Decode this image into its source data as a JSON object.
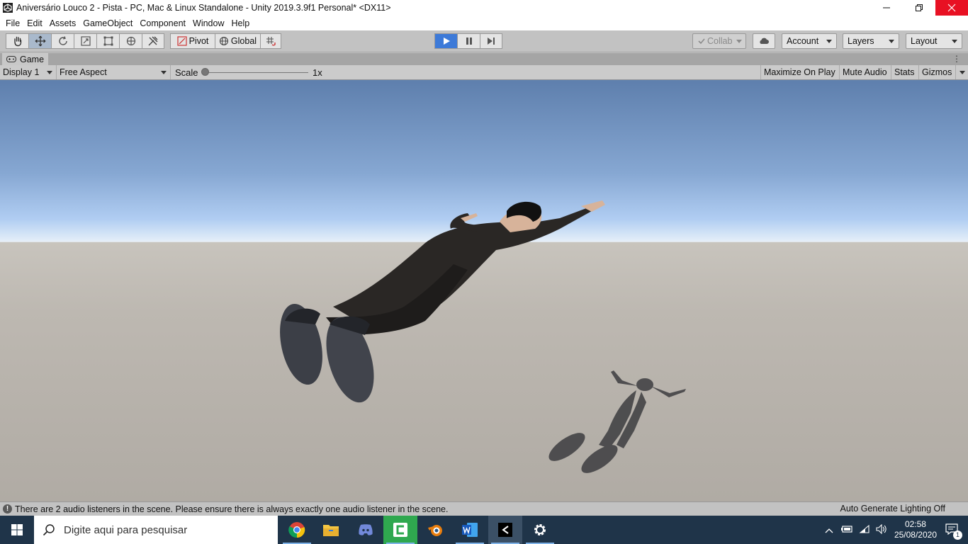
{
  "window": {
    "title": "Aniversário Louco 2 - Pista - PC, Mac & Linux Standalone - Unity 2019.3.9f1 Personal* <DX11>"
  },
  "menu": [
    "File",
    "Edit",
    "Assets",
    "GameObject",
    "Component",
    "Window",
    "Help"
  ],
  "toolbar": {
    "pivot_label": "Pivot",
    "global_label": "Global",
    "collab_label": "Collab",
    "account_label": "Account",
    "layers_label": "Layers",
    "layout_label": "Layout"
  },
  "tab": {
    "game_label": "Game"
  },
  "game_bar": {
    "display": "Display 1",
    "aspect": "Free Aspect",
    "scale_label": "Scale",
    "scale_value": "1x",
    "scale_fraction": 0.0,
    "maximize": "Maximize On Play",
    "mute": "Mute Audio",
    "stats": "Stats",
    "gizmos": "Gizmos"
  },
  "status": {
    "message": "There are 2 audio listeners in the scene. Please ensure there is always exactly one audio listener in the scene.",
    "lighting": "Auto Generate Lighting Off"
  },
  "taskbar": {
    "search_placeholder": "Digite aqui para pesquisar",
    "time": "02:58",
    "date": "25/08/2020",
    "notifications": "1"
  },
  "colors": {
    "play_active": "#3d7ad8",
    "close_button": "#e81123",
    "taskbar": "#1f3449"
  }
}
